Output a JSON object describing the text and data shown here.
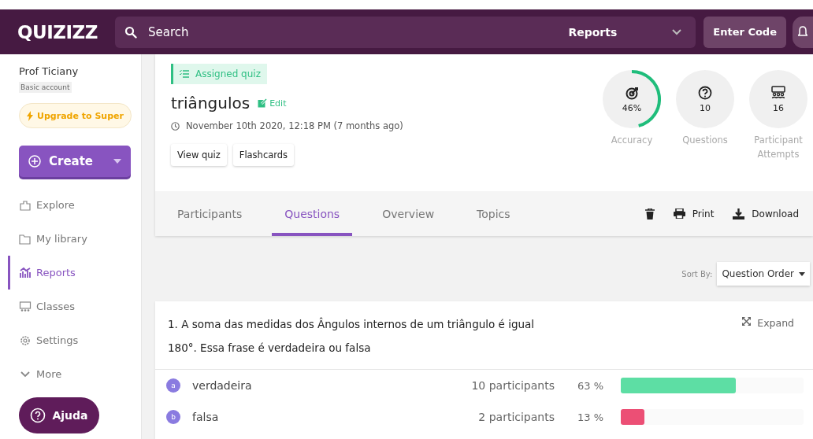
{
  "header": {
    "logo": "QUIZIZZ",
    "search_placeholder": "Search",
    "scope": "Reports",
    "enter_code": "Enter Code"
  },
  "sidebar": {
    "user": "Prof Ticiany",
    "account": "Basic account",
    "upgrade": "Upgrade to Super",
    "create": "Create",
    "items": [
      {
        "label": "Explore",
        "selected": false
      },
      {
        "label": "My library",
        "selected": false
      },
      {
        "label": "Reports",
        "selected": true
      },
      {
        "label": "Classes",
        "selected": false
      },
      {
        "label": "Settings",
        "selected": false
      },
      {
        "label": "More",
        "selected": false
      }
    ],
    "help": "Ajuda"
  },
  "quiz": {
    "tag": "Assigned quiz",
    "title": "triângulos",
    "edit": "Edit",
    "date": "November 10th 2020, 12:18 PM (7 months ago)",
    "buttons": [
      "View quiz",
      "Flashcards"
    ],
    "stats": [
      {
        "kind": "accuracy",
        "value": "46%",
        "label": "Accuracy",
        "level": 0.46
      },
      {
        "kind": "questions",
        "value": "10",
        "label": "Questions"
      },
      {
        "kind": "attempts",
        "value": "16",
        "label": "Participant Attempts"
      }
    ]
  },
  "tabs": [
    {
      "label": "Participants",
      "selected": false
    },
    {
      "label": "Questions",
      "selected": true
    },
    {
      "label": "Overview",
      "selected": false
    },
    {
      "label": "Topics",
      "selected": false
    }
  ],
  "actions": [
    {
      "kind": "delete"
    },
    {
      "kind": "print",
      "label": "Print"
    },
    {
      "kind": "download",
      "label": "Download"
    }
  ],
  "sort": {
    "label": "Sort By:",
    "value": "Question Order"
  },
  "question": {
    "text": "1. A soma das medidas dos Ângulos internos de um triângulo é igual 180°. Essa frase é verdadeira ou falsa",
    "expand": "Expand",
    "answers": [
      {
        "letter": "a",
        "text": "verdadeira",
        "count": "10 participants",
        "percent": "63 %",
        "level": 0.63,
        "color": "#5ddea4"
      },
      {
        "letter": "b",
        "text": "falsa",
        "count": "2 participants",
        "percent": "13 %",
        "level": 0.13,
        "color": "#ec4f75"
      }
    ]
  }
}
